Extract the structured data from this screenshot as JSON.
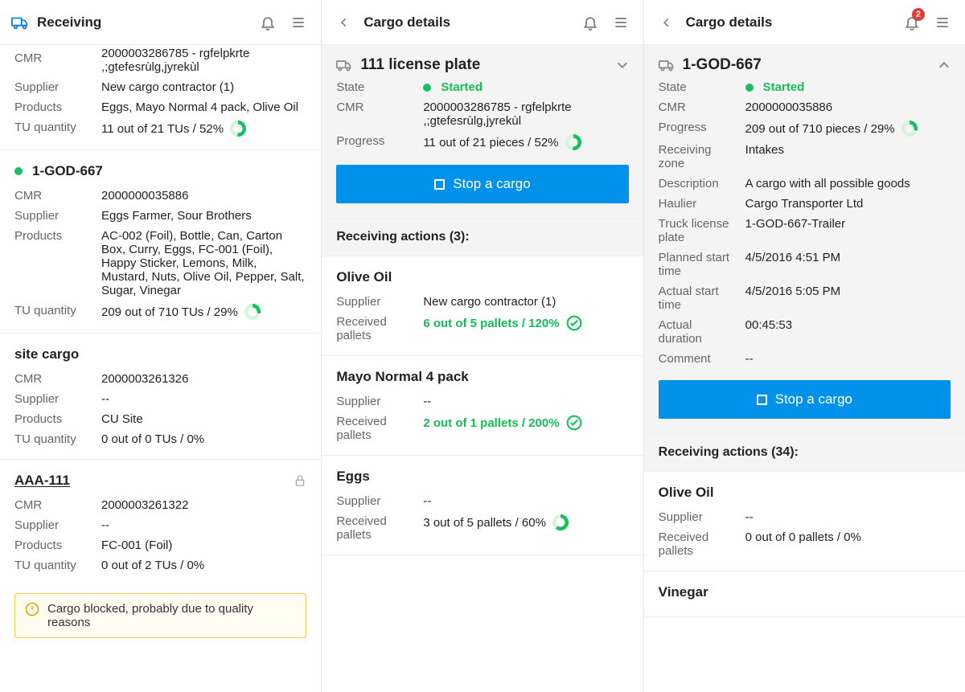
{
  "col1": {
    "title": "Receiving",
    "partialItem": {
      "kv": [
        {
          "k": "CMR",
          "v": "2000003286785 - rgfelpkrte ,;gtefesrùlg,jyrekùl"
        },
        {
          "k": "Supplier",
          "v": "New cargo contractor (1)"
        },
        {
          "k": "Products",
          "v": "Eggs, Mayo Normal 4 pack, Olive Oil"
        }
      ],
      "tuLabel": "TU quantity",
      "tuValue": "11 out of 21 TUs / 52%",
      "tuPct": 52
    },
    "item2": {
      "title": "1-GOD-667",
      "kv": [
        {
          "k": "CMR",
          "v": "2000000035886"
        },
        {
          "k": "Supplier",
          "v": "Eggs Farmer, Sour Brothers"
        },
        {
          "k": "Products",
          "v": "AC-002 (Foil), Bottle, Can, Carton Box, Curry, Eggs, FC-001 (Foil), Happy Sticker, Lemons, Milk, Mustard, Nuts, Olive Oil, Pepper, Salt, Sugar, Vinegar"
        }
      ],
      "tuLabel": "TU quantity",
      "tuValue": "209 out of 710 TUs / 29%",
      "tuPct": 29
    },
    "item3": {
      "title": "site cargo",
      "kv": [
        {
          "k": "CMR",
          "v": "2000003261326"
        },
        {
          "k": "Supplier",
          "v": "--"
        },
        {
          "k": "Products",
          "v": "CU Site"
        },
        {
          "k": "TU quantity",
          "v": "0 out of 0 TUs / 0%"
        }
      ]
    },
    "item4": {
      "title": "AAA-111",
      "kv": [
        {
          "k": "CMR",
          "v": "2000003261322"
        },
        {
          "k": "Supplier",
          "v": "--"
        },
        {
          "k": "Products",
          "v": "FC-001 (Foil)"
        },
        {
          "k": "TU quantity",
          "v": "0 out of 2 TUs / 0%"
        }
      ],
      "warn": "Cargo blocked, probably due to quality reasons"
    }
  },
  "col2": {
    "title": "Cargo details",
    "expanded": {
      "title": "111 license plate",
      "stateLabel": "State",
      "stateValue": "Started",
      "cmrLabel": "CMR",
      "cmrValue": "2000003286785 - rgfelpkrte ,;gtefesrùlg,jyrekùl",
      "progLabel": "Progress",
      "progValue": "11 out of 21 pieces / 52%",
      "progPct": 52,
      "btn": "Stop a cargo"
    },
    "actionsTitle": "Receiving actions (3):",
    "actions": [
      {
        "name": "Olive Oil",
        "supLabel": "Supplier",
        "supVal": "New cargo contractor (1)",
        "recLabel": "Received pallets",
        "recVal": "6 out of 5 pallets / 120%",
        "status": "done"
      },
      {
        "name": "Mayo Normal 4 pack",
        "supLabel": "Supplier",
        "supVal": "--",
        "recLabel": "Received pallets",
        "recVal": "2 out of 1 pallets / 200%",
        "status": "done"
      },
      {
        "name": "Eggs",
        "supLabel": "Supplier",
        "supVal": "--",
        "recLabel": "Received pallets",
        "recVal": "3 out of 5 pallets / 60%",
        "status": "partial",
        "pct": 60
      }
    ]
  },
  "col3": {
    "title": "Cargo details",
    "notif": "2",
    "expanded": {
      "title": "1-GOD-667",
      "rows": [
        {
          "k": "State",
          "v": "Started",
          "state": true
        },
        {
          "k": "CMR",
          "v": "2000000035886"
        },
        {
          "k": "Progress",
          "v": "209 out of 710 pieces / 29%",
          "ring": 29
        },
        {
          "k": "Receiving zone",
          "v": "Intakes"
        },
        {
          "k": "Description",
          "v": "A cargo with all possible goods"
        },
        {
          "k": "Haulier",
          "v": "Cargo Transporter Ltd"
        },
        {
          "k": "Truck license plate",
          "v": "1-GOD-667-Trailer"
        },
        {
          "k": "Planned start time",
          "v": "4/5/2016 4:51 PM"
        },
        {
          "k": "Actual start time",
          "v": "4/5/2016 5:05 PM"
        },
        {
          "k": "Actual duration",
          "v": "00:45:53"
        },
        {
          "k": "Comment",
          "v": "--"
        }
      ],
      "btn": "Stop a cargo"
    },
    "actionsTitle": "Receiving actions (34):",
    "actions": [
      {
        "name": "Olive Oil",
        "supLabel": "Supplier",
        "supVal": "--",
        "recLabel": "Received pallets",
        "recVal": "0 out of 0 pallets / 0%"
      },
      {
        "name": "Vinegar"
      }
    ]
  }
}
